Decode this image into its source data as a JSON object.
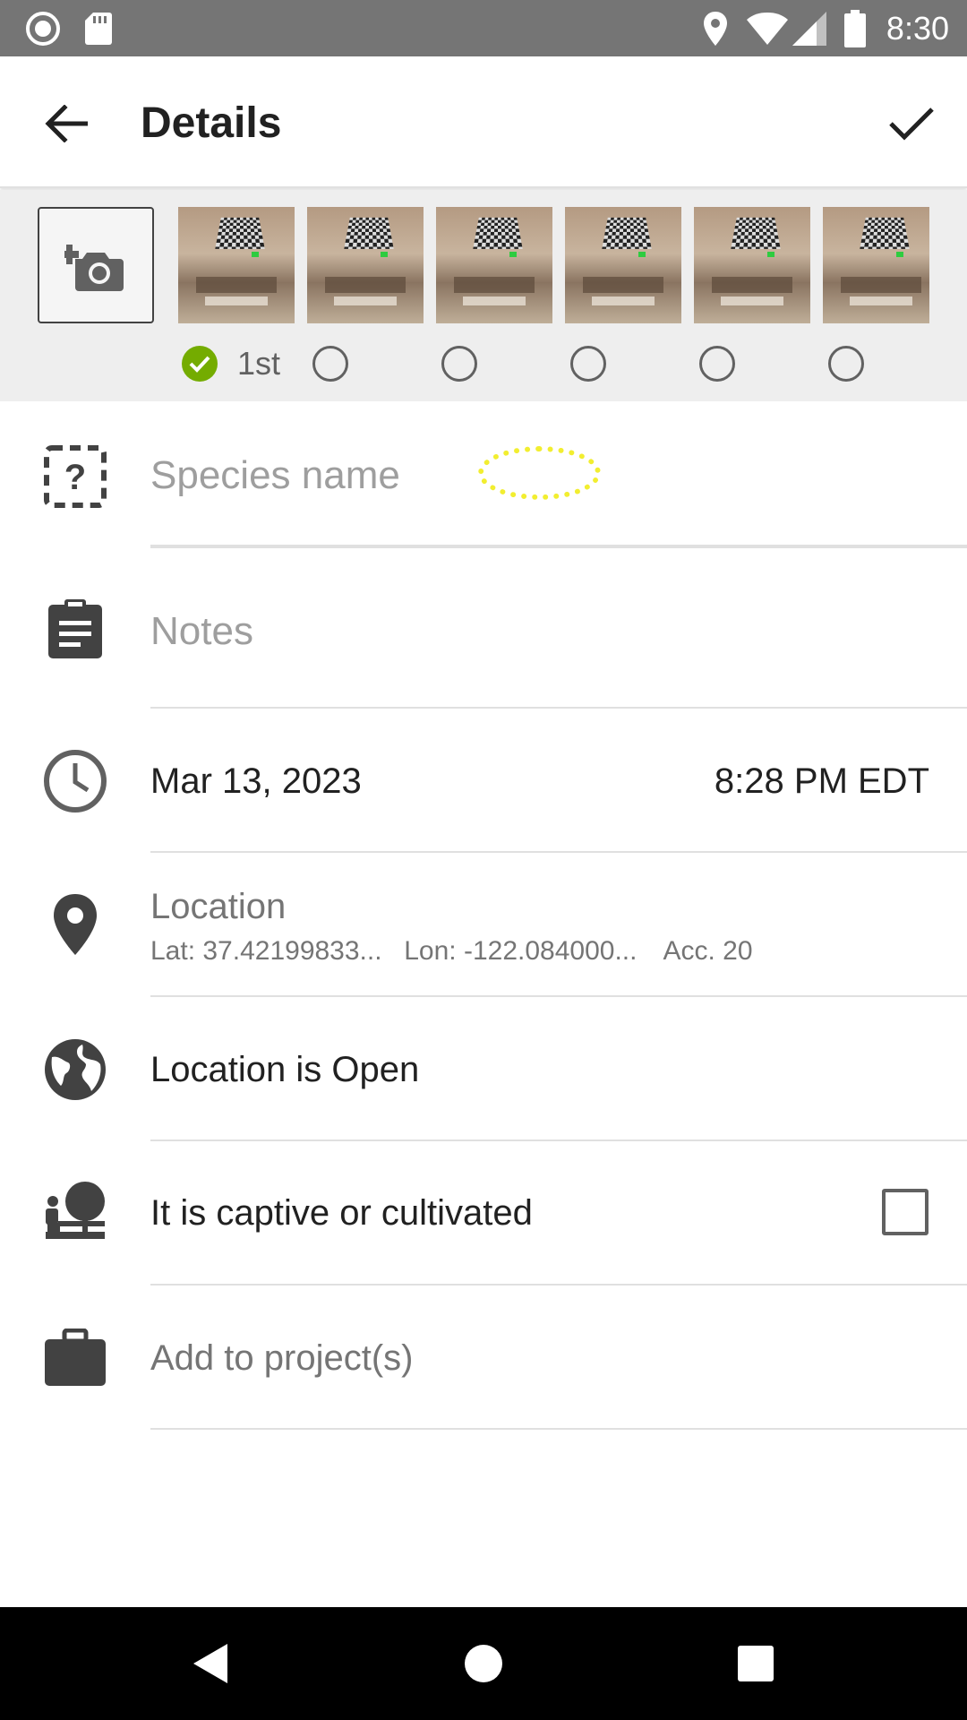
{
  "status_bar": {
    "time": "8:30",
    "icons": [
      "record-icon",
      "sd-card-icon",
      "location-icon",
      "wifi-icon",
      "signal-icon",
      "battery-icon"
    ]
  },
  "app_bar": {
    "title": "Details",
    "back_icon": "arrow-back-icon",
    "done_icon": "check-icon"
  },
  "photos": {
    "add_icon": "add-camera-icon",
    "first_label": "1st",
    "count": 6,
    "selected_index": 0
  },
  "form": {
    "species_placeholder": "Species name",
    "notes_placeholder": "Notes",
    "date": "Mar 13, 2023",
    "time": "8:28 PM EDT",
    "location_label": "Location",
    "lat": "Lat: 37.42199833...",
    "lon": "Lon: -122.084000...",
    "acc": "Acc. 20",
    "geoprivacy": "Location is Open",
    "captive_label": "It is captive or cultivated",
    "captive_checked": false,
    "projects_label": "Add to project(s)"
  },
  "colors": {
    "accent_green": "#74ac00",
    "status_bar": "#757575",
    "placeholder": "#9e9e9e"
  },
  "nav": {
    "back": "nav-back-icon",
    "home": "nav-home-icon",
    "recents": "nav-recents-icon"
  }
}
